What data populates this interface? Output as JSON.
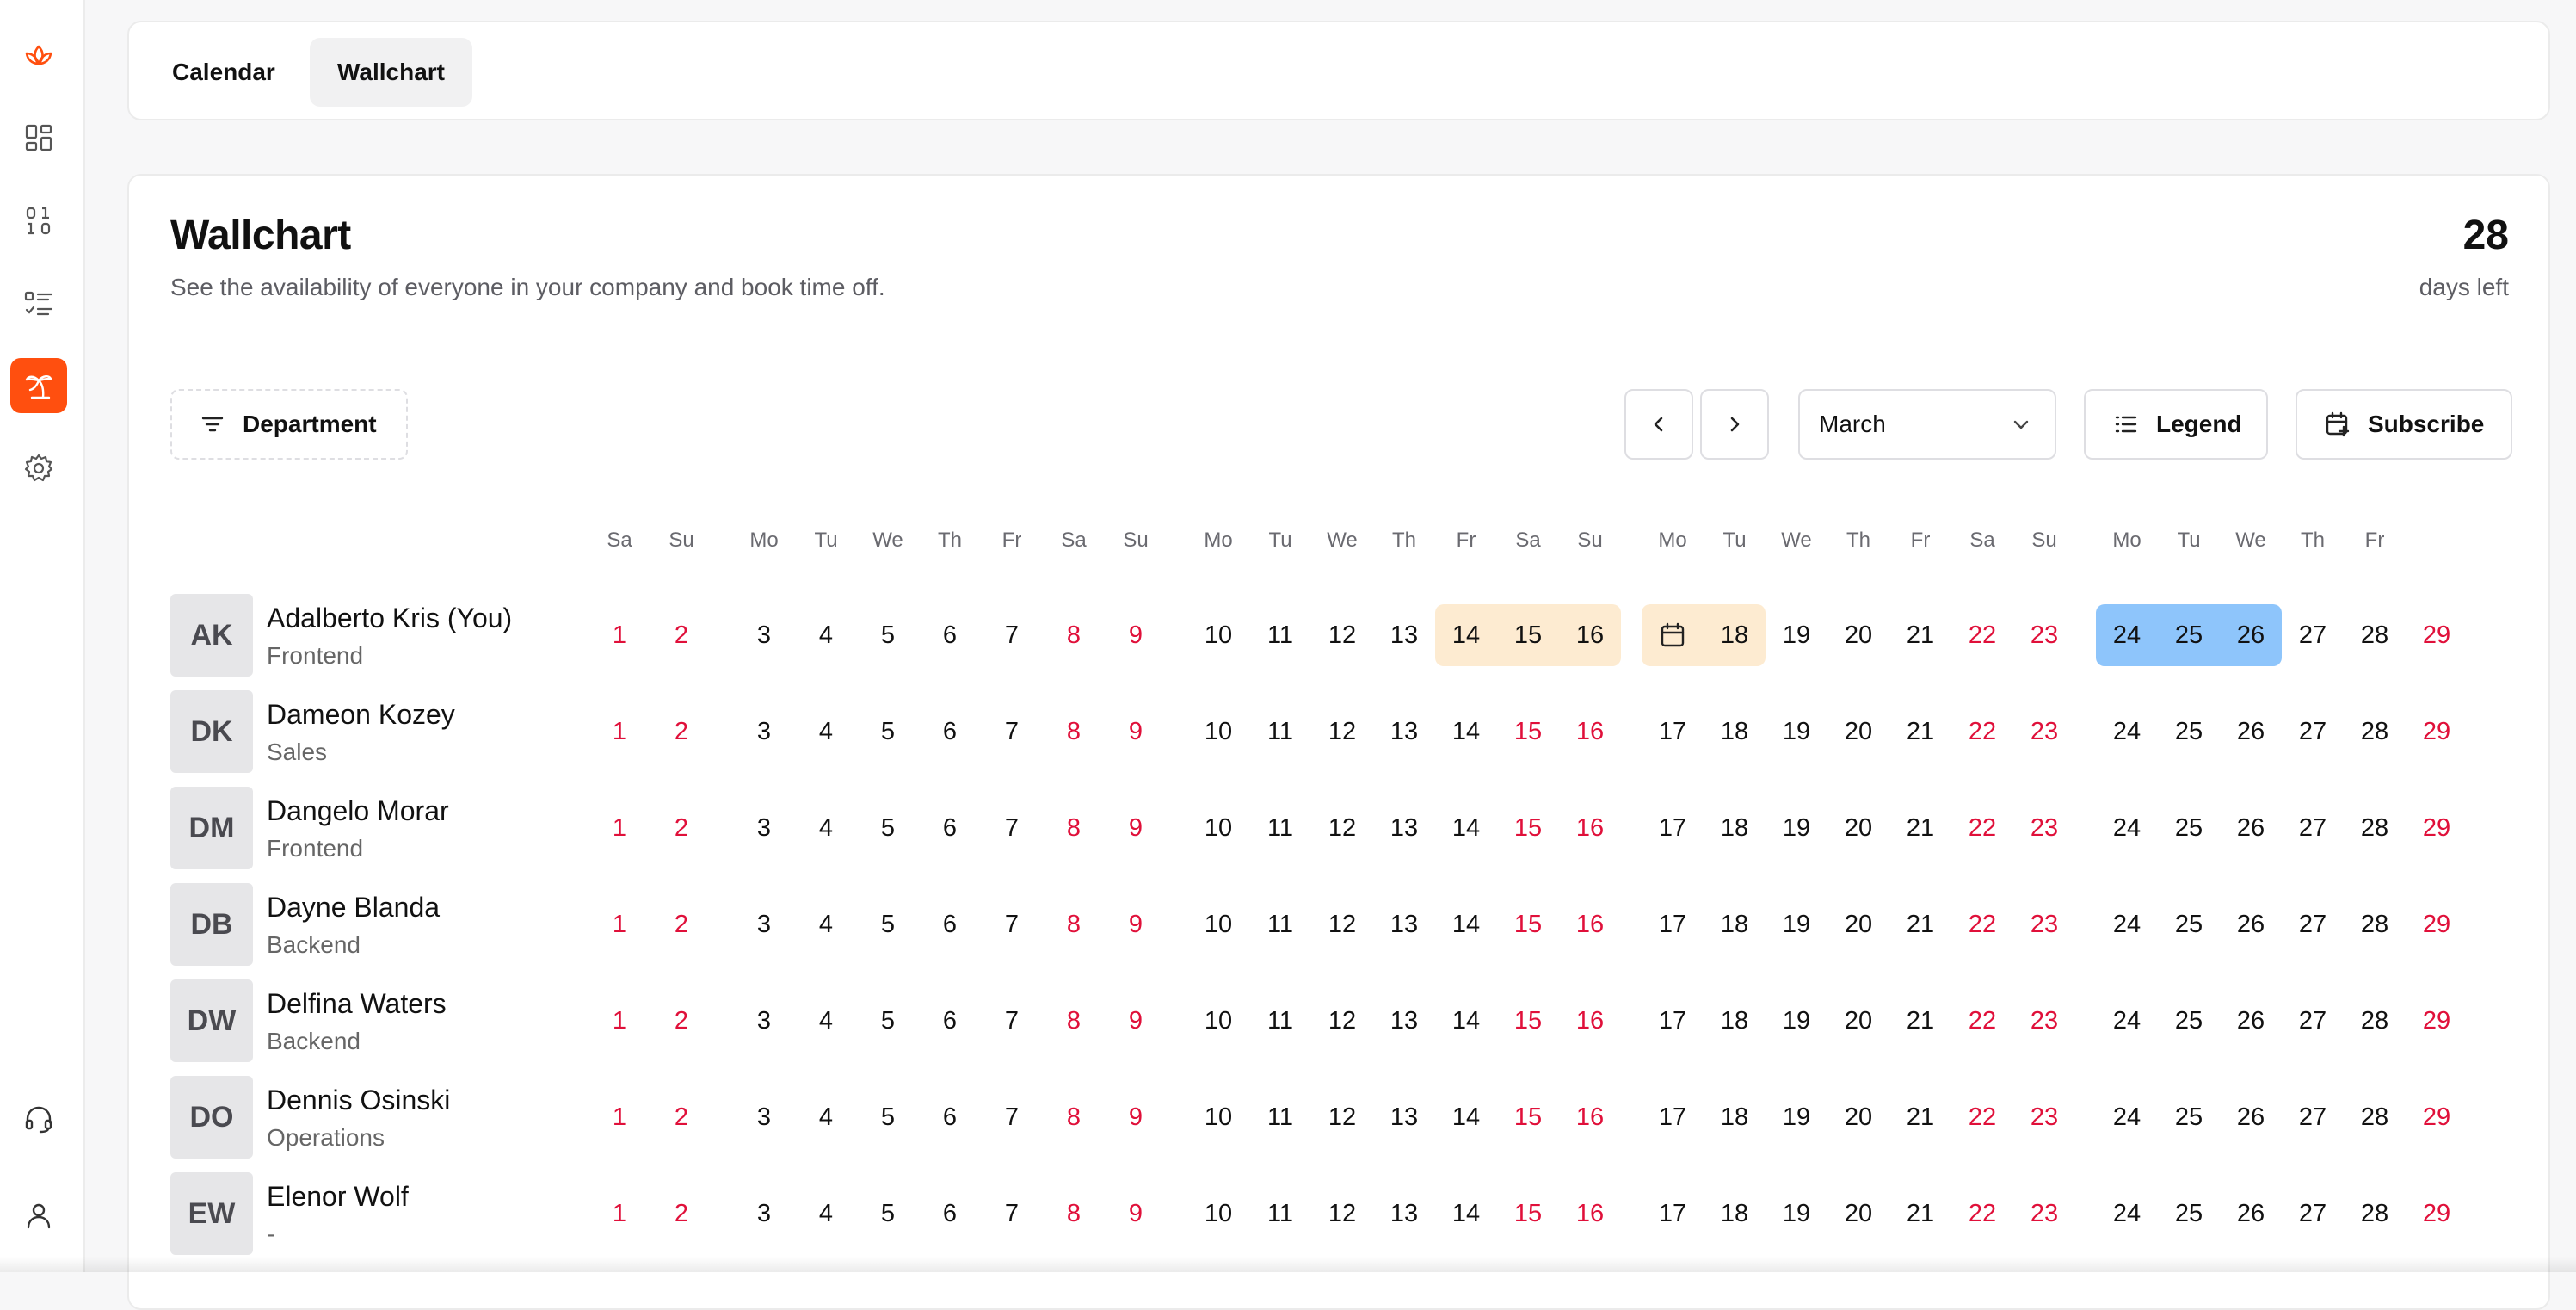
{
  "sidebar": {
    "items": [
      {
        "name": "logo-lotus-icon",
        "interactable": true,
        "active": false
      },
      {
        "name": "dashboard-icon",
        "interactable": true,
        "active": false
      },
      {
        "name": "binary-icon",
        "interactable": true,
        "active": false
      },
      {
        "name": "checklist-icon",
        "interactable": true,
        "active": false
      },
      {
        "name": "palm-tree-icon",
        "interactable": true,
        "active": true
      },
      {
        "name": "gear-icon",
        "interactable": true,
        "active": false
      },
      {
        "name": "headset-icon",
        "interactable": true,
        "active": false
      },
      {
        "name": "user-icon",
        "interactable": true,
        "active": false
      }
    ]
  },
  "tabs": [
    {
      "label": "Calendar",
      "active": false
    },
    {
      "label": "Wallchart",
      "active": true
    }
  ],
  "header": {
    "title": "Wallchart",
    "subtitle": "See the availability of everyone in your company and book time off.",
    "days_left_value": "28",
    "days_left_label": "days left"
  },
  "toolbar": {
    "department_label": "Department",
    "month_value": "March",
    "legend_label": "Legend",
    "subscribe_label": "Subscribe"
  },
  "calendar": {
    "day_headers": [
      "Sa",
      "Su",
      "Mo",
      "Tu",
      "We",
      "Th",
      "Fr",
      "Sa",
      "Su",
      "Mo",
      "Tu",
      "We",
      "Th",
      "Fr",
      "Sa",
      "Su",
      "Mo",
      "Tu",
      "We",
      "Th",
      "Fr",
      "Sa",
      "Su",
      "Mo",
      "Tu",
      "We",
      "Th",
      "Fr"
    ],
    "days": [
      "1",
      "2",
      "3",
      "4",
      "5",
      "6",
      "7",
      "8",
      "9",
      "10",
      "11",
      "12",
      "13",
      "14",
      "15",
      "16",
      "17",
      "18",
      "19",
      "20",
      "21",
      "22",
      "23",
      "24",
      "25",
      "26",
      "27",
      "28"
    ],
    "overflow_day": "29",
    "weekend_color": "#e0103a",
    "pending_color": "#fdebd1",
    "approved_color": "#8ec5fb"
  },
  "people": [
    {
      "initials": "AK",
      "name": "Adalberto Kris (You)",
      "dept": "Frontend",
      "pending": [
        14,
        15,
        16,
        18
      ],
      "approved": [
        24,
        25,
        26
      ],
      "icon_day": 17
    },
    {
      "initials": "DK",
      "name": "Dameon Kozey",
      "dept": "Sales"
    },
    {
      "initials": "DM",
      "name": "Dangelo Morar",
      "dept": "Frontend"
    },
    {
      "initials": "DB",
      "name": "Dayne Blanda",
      "dept": "Backend"
    },
    {
      "initials": "DW",
      "name": "Delfina Waters",
      "dept": "Backend"
    },
    {
      "initials": "DO",
      "name": "Dennis Osinski",
      "dept": "Operations"
    },
    {
      "initials": "EW",
      "name": "Elenor Wolf",
      "dept": "-"
    }
  ]
}
